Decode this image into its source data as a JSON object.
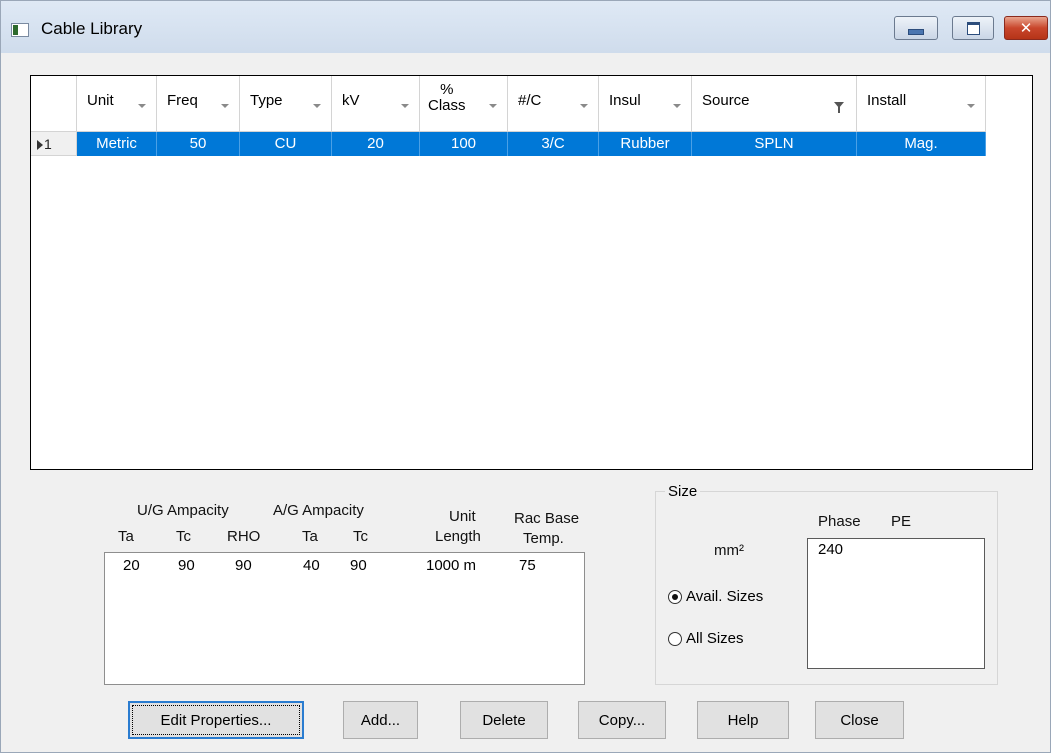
{
  "window": {
    "title": "Cable Library"
  },
  "grid": {
    "columns": [
      {
        "label": "Unit",
        "width": 80
      },
      {
        "label": "Freq",
        "width": 83
      },
      {
        "label": "Type",
        "width": 92
      },
      {
        "label": "kV",
        "width": 88
      },
      {
        "label": "%\nClass",
        "width": 88
      },
      {
        "label": "#/C",
        "width": 91
      },
      {
        "label": "Insul",
        "width": 93
      },
      {
        "label": "Source",
        "width": 165
      },
      {
        "label": "Install",
        "width": 129
      }
    ],
    "rows": [
      {
        "index": "1",
        "cells": [
          "Metric",
          "50",
          "CU",
          "20",
          "100",
          "3/C",
          "Rubber",
          "SPLN",
          "Mag."
        ]
      }
    ],
    "selection_color": "#0078d7"
  },
  "ampacity": {
    "ug_title": "U/G Ampacity",
    "ag_title": "A/G Ampacity",
    "unit_title": "Unit",
    "unit_sub": "Length",
    "rac_title": "Rac Base",
    "rac_sub": "Temp.",
    "sub_headers": [
      "Ta",
      "Tc",
      "RHO",
      "Ta",
      "Tc"
    ],
    "values": [
      "20",
      "90",
      "90",
      "40",
      "90",
      "1000 m",
      "75"
    ]
  },
  "size": {
    "legend": "Size",
    "unit": "mm²",
    "phase_label": "Phase",
    "pe_label": "PE",
    "avail_label": "Avail. Sizes",
    "all_label": "All Sizes",
    "selected": "avail",
    "phase_values": [
      "240"
    ]
  },
  "buttons": {
    "edit": "Edit Properties...",
    "add": "Add...",
    "delete": "Delete",
    "copy": "Copy...",
    "help": "Help",
    "close": "Close"
  }
}
